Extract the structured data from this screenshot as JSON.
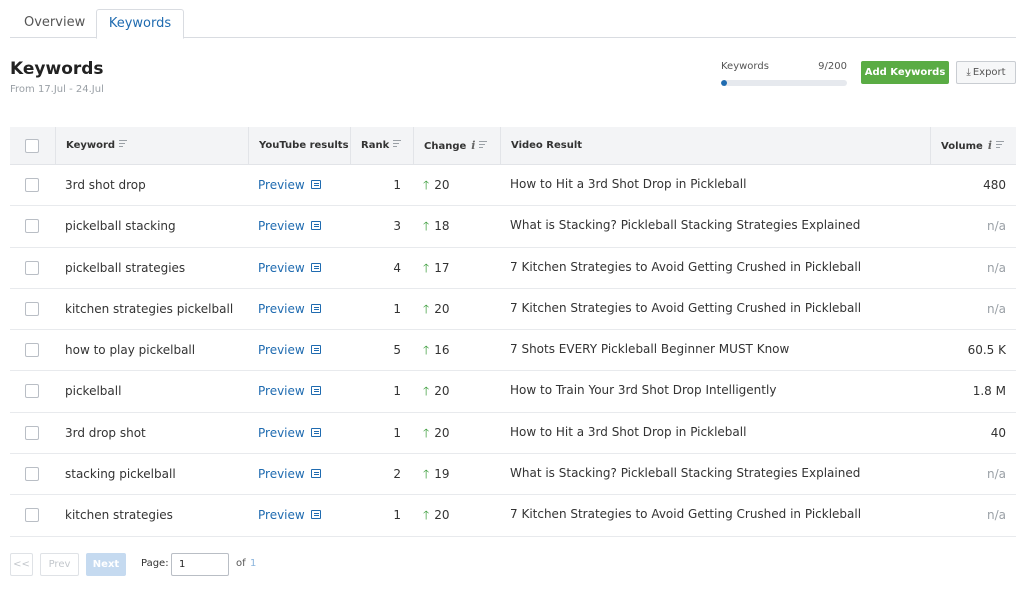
{
  "tabs": [
    {
      "label": "Overview"
    },
    {
      "label": "Keywords"
    }
  ],
  "header": {
    "title": "Keywords",
    "date_range": "From 17.Jul - 24.Jul"
  },
  "usage": {
    "label": "Keywords",
    "count": "9/200",
    "fill_percent": 4.5
  },
  "actions": {
    "add_label": "Add Keywords",
    "export_label": "Export"
  },
  "columns": {
    "keyword": "Keyword",
    "youtube": "YouTube results",
    "rank": "Rank",
    "change": "Change",
    "video": "Video Result",
    "volume": "Volume"
  },
  "rows": [
    {
      "keyword": "3rd shot drop",
      "preview": "Preview",
      "rank": "1",
      "change": "20",
      "video": "How to Hit a 3rd Shot Drop in Pickleball",
      "volume": "480"
    },
    {
      "keyword": "pickelball stacking",
      "preview": "Preview",
      "rank": "3",
      "change": "18",
      "video": "What is Stacking? Pickleball Stacking Strategies Explained",
      "volume": "n/a"
    },
    {
      "keyword": "pickelball strategies",
      "preview": "Preview",
      "rank": "4",
      "change": "17",
      "video": "7 Kitchen Strategies to Avoid Getting Crushed in Pickleball",
      "volume": "n/a"
    },
    {
      "keyword": "kitchen strategies pickelball",
      "preview": "Preview",
      "rank": "1",
      "change": "20",
      "video": "7 Kitchen Strategies to Avoid Getting Crushed in Pickleball",
      "volume": "n/a"
    },
    {
      "keyword": "how to play pickelball",
      "preview": "Preview",
      "rank": "5",
      "change": "16",
      "video": "7 Shots EVERY Pickleball Beginner MUST Know",
      "volume": "60.5 K"
    },
    {
      "keyword": "pickelball",
      "preview": "Preview",
      "rank": "1",
      "change": "20",
      "video": "How to Train Your 3rd Shot Drop Intelligently",
      "volume": "1.8 M"
    },
    {
      "keyword": "3rd drop shot",
      "preview": "Preview",
      "rank": "1",
      "change": "20",
      "video": "How to Hit a 3rd Shot Drop in Pickleball",
      "volume": "40"
    },
    {
      "keyword": "stacking pickelball",
      "preview": "Preview",
      "rank": "2",
      "change": "19",
      "video": "What is Stacking? Pickleball Stacking Strategies Explained",
      "volume": "n/a"
    },
    {
      "keyword": "kitchen strategies",
      "preview": "Preview",
      "rank": "1",
      "change": "20",
      "video": "7 Kitchen Strategies to Avoid Getting Crushed in Pickleball",
      "volume": "n/a"
    }
  ],
  "pagination": {
    "first_label": "<<",
    "prev_label": "Prev",
    "next_label": "Next",
    "page_label": "Page:",
    "current_page": "1",
    "of_label": "of",
    "total_pages": "1"
  },
  "colors": {
    "accent": "#1f6bb0",
    "add_button": "#5aac44",
    "change_up": "#3a9c3a"
  },
  "icons": {
    "sort": "sort-lines-icon",
    "info": "info-icon",
    "preview": "preview-window-icon",
    "change_up": "up-arrow-icon",
    "export": "download-icon"
  }
}
